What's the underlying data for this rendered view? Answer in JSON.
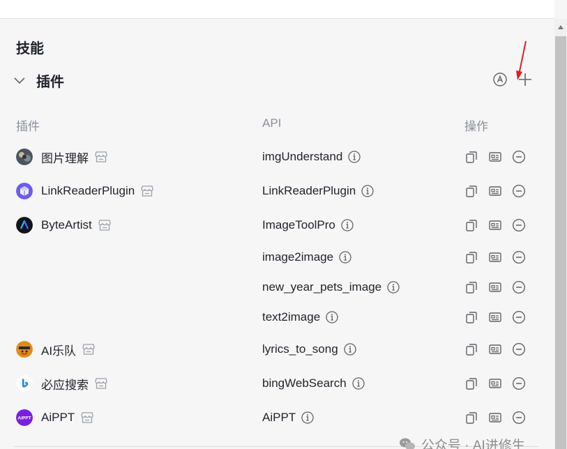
{
  "section": {
    "title": "技能"
  },
  "plugins_section": {
    "title": "插件"
  },
  "columns": {
    "plugin": "插件",
    "api": "API",
    "ops": "操作"
  },
  "rows": [
    {
      "plugin": "图片理解",
      "api": "imgUnderstand",
      "avatar": "photo-avatar"
    },
    {
      "plugin": "LinkReaderPlugin",
      "api": "LinkReaderPlugin",
      "avatar": "cube-avatar"
    },
    {
      "plugin": "ByteArtist",
      "api": "ImageToolPro",
      "avatar": "byteartist-avatar"
    },
    {
      "plugin": "",
      "api": "image2image"
    },
    {
      "plugin": "",
      "api": "new_year_pets_image"
    },
    {
      "plugin": "",
      "api": "text2image"
    },
    {
      "plugin": "AI乐队",
      "api": "lyrics_to_song",
      "avatar": "band-avatar"
    },
    {
      "plugin": "必应搜索",
      "api": "bingWebSearch",
      "avatar": "bing-avatar"
    },
    {
      "plugin": "AiPPT",
      "api": "AiPPT",
      "avatar": "aippt-avatar"
    }
  ],
  "aippt_avatar_text": "AiPPT",
  "watermark": {
    "text": "公众号 · AI进修生"
  },
  "colors": {
    "background": "#f6f6f7",
    "icon_gray": "#5f6368",
    "annotation_red": "#e02020",
    "cube_purple": "#6b5cf0",
    "aippt_purple": "#7a1fe0",
    "bing_blue": "#1e88e5"
  }
}
